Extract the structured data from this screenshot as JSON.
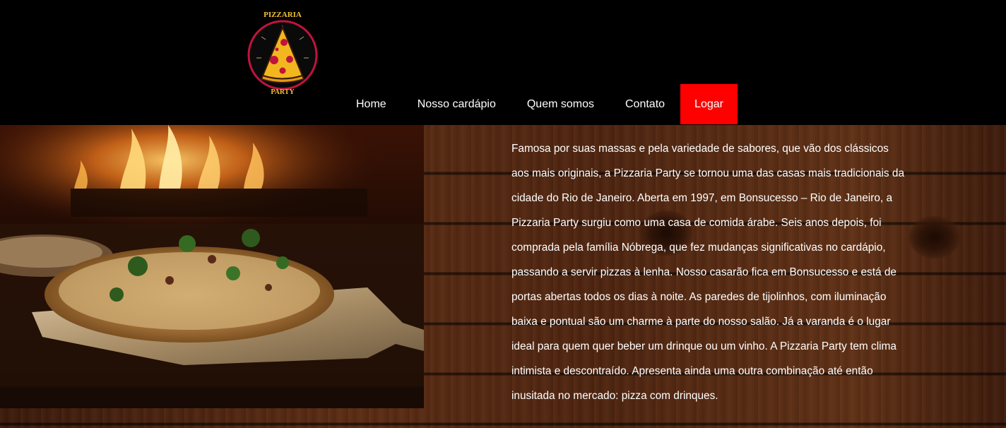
{
  "brand": {
    "logo_top_text": "PIZZARIA",
    "logo_bottom_text": "PARTY"
  },
  "nav": {
    "items": [
      {
        "label": "Home"
      },
      {
        "label": "Nosso cardápio"
      },
      {
        "label": "Quem somos"
      },
      {
        "label": "Contato"
      },
      {
        "label": "Logar"
      }
    ]
  },
  "about": {
    "text": "Famosa por suas massas e pela variedade de sabores, que vão dos clássicos aos mais originais, a Pizzaria Party se tornou uma das casas mais tradicionais da cidade do Rio de Janeiro. Aberta em 1997, em Bonsucesso – Rio de Janeiro, a Pizzaria Party surgiu como uma casa de comida árabe. Seis anos depois, foi comprada pela família Nóbrega, que fez mudanças significativas no cardápio, passando a servir pizzas à lenha. Nosso casarão fica em Bonsucesso e está de portas abertas todos os dias à noite. As paredes de tijolinhos, com iluminação baixa e pontual são um charme à parte do nosso salão. Já a varanda é o lugar ideal para quem quer beber um drinque ou um vinho. A Pizzaria Party tem clima intimista e descontraído. Apresenta ainda uma outra combinação até então inusitada no mercado: pizza com drinques."
  },
  "colors": {
    "header_bg": "#000000",
    "login_bg": "#ff0000",
    "logo_ring": "#c0143c",
    "logo_text": "#f2c230"
  }
}
